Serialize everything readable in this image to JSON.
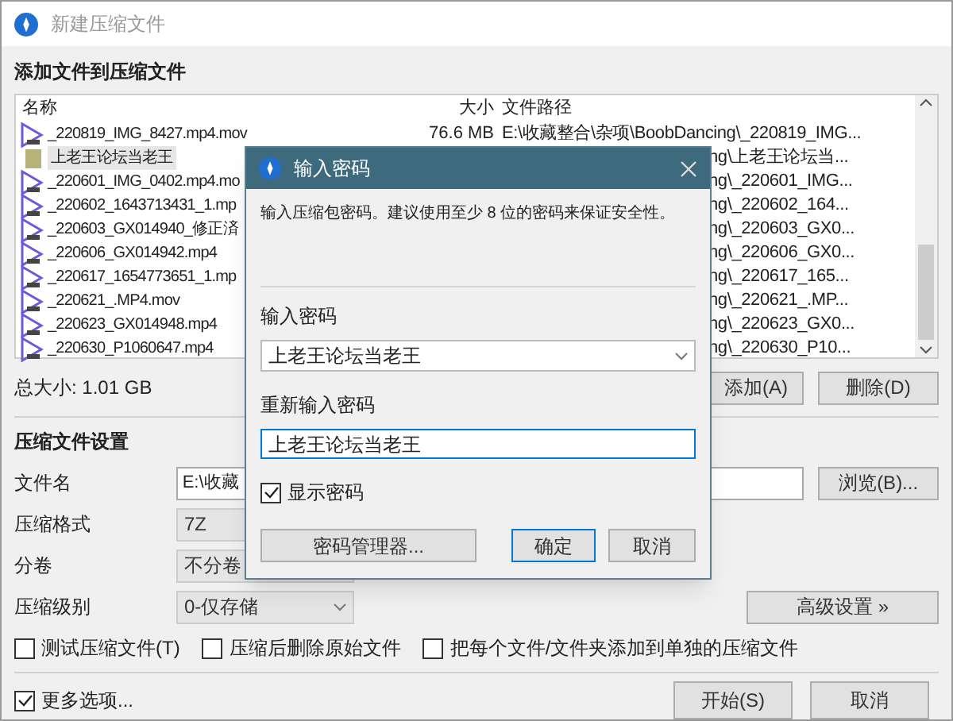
{
  "window": {
    "title": "新建压缩文件"
  },
  "files_section": {
    "title": "添加文件到压缩文件"
  },
  "table": {
    "columns": [
      "名称",
      "大小",
      "文件路径"
    ],
    "rows": [
      {
        "kind": "video",
        "name": "_220819_IMG_8427.mp4.mov",
        "size": "76.6 MB",
        "path": "E:\\收藏整合\\杂项\\BoobDancing\\_220819_IMG...",
        "selected": false
      },
      {
        "kind": "folder",
        "name": "上老王论坛当老王",
        "path": "ng\\上老王论坛当...",
        "selected": true
      },
      {
        "kind": "video",
        "name": "_220601_IMG_0402.mp4.mo",
        "path": "ng\\_220601_IMG...",
        "selected": false
      },
      {
        "kind": "video",
        "name": "_220602_1643713431_1.mp",
        "path": "ng\\_220602_164...",
        "selected": false
      },
      {
        "kind": "video",
        "name": "_220603_GX014940_修正済",
        "path": "ng\\_220603_GX0...",
        "selected": false
      },
      {
        "kind": "video",
        "name": "_220606_GX014942.mp4",
        "path": "ng\\_220606_GX0...",
        "selected": false
      },
      {
        "kind": "video",
        "name": "_220617_1654773651_1.mp",
        "path": "ng\\_220617_165...",
        "selected": false
      },
      {
        "kind": "video",
        "name": "_220621_.MP4.mov",
        "path": "ng\\_220621_.MP...",
        "selected": false
      },
      {
        "kind": "video",
        "name": "_220623_GX014948.mp4",
        "path": "ng\\_220623_GX0...",
        "selected": false
      },
      {
        "kind": "video",
        "name": "_220630_P1060647.mp4",
        "path": "ng\\_220630_P10...",
        "selected": false
      }
    ]
  },
  "total_size": "总大小: 1.01 GB",
  "list_buttons": [
    "添加(A)",
    "删除(D)"
  ],
  "settings": {
    "title": "压缩文件设置",
    "file_name": {
      "label": "文件名",
      "value": "E:\\收藏",
      "browse": "浏览(B)..."
    },
    "format": {
      "label": "压缩格式",
      "value": "7Z"
    },
    "split": {
      "label": "分卷",
      "value": "不分卷"
    },
    "level": {
      "label": "压缩级别",
      "value": "0-仅存储"
    },
    "advanced": "高级设置 »",
    "options": [
      {
        "label": "测试压缩文件(T)",
        "checked": false
      },
      {
        "label": "压缩后删除原始文件",
        "checked": false
      },
      {
        "label": "把每个文件/文件夹添加到单独的压缩文件",
        "checked": false
      }
    ]
  },
  "more_options": {
    "label": "更多选项...",
    "checked": true
  },
  "footer_buttons": [
    "开始(S)",
    "取消"
  ],
  "dialog": {
    "title": "输入密码",
    "hint": "输入压缩包密码。建议使用至少 8 位的密码来保证安全性。",
    "password_label": "输入密码",
    "password": "上老王论坛当老王",
    "confirm_label": "重新输入密码",
    "confirm": "上老王论坛当老王",
    "show_password": {
      "label": "显示密码",
      "checked": true
    },
    "buttons": [
      "密码管理器...",
      "确定",
      "取消"
    ]
  }
}
